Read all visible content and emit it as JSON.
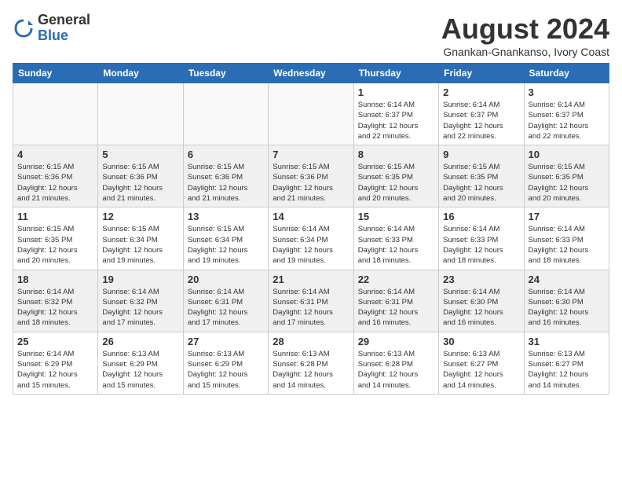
{
  "logo": {
    "general": "General",
    "blue": "Blue"
  },
  "title": {
    "month_year": "August 2024",
    "location": "Gnankan-Gnankanso, Ivory Coast"
  },
  "weekdays": [
    "Sunday",
    "Monday",
    "Tuesday",
    "Wednesday",
    "Thursday",
    "Friday",
    "Saturday"
  ],
  "weeks": [
    [
      {
        "day": "",
        "info": ""
      },
      {
        "day": "",
        "info": ""
      },
      {
        "day": "",
        "info": ""
      },
      {
        "day": "",
        "info": ""
      },
      {
        "day": "1",
        "info": "Sunrise: 6:14 AM\nSunset: 6:37 PM\nDaylight: 12 hours\nand 22 minutes."
      },
      {
        "day": "2",
        "info": "Sunrise: 6:14 AM\nSunset: 6:37 PM\nDaylight: 12 hours\nand 22 minutes."
      },
      {
        "day": "3",
        "info": "Sunrise: 6:14 AM\nSunset: 6:37 PM\nDaylight: 12 hours\nand 22 minutes."
      }
    ],
    [
      {
        "day": "4",
        "info": "Sunrise: 6:15 AM\nSunset: 6:36 PM\nDaylight: 12 hours\nand 21 minutes."
      },
      {
        "day": "5",
        "info": "Sunrise: 6:15 AM\nSunset: 6:36 PM\nDaylight: 12 hours\nand 21 minutes."
      },
      {
        "day": "6",
        "info": "Sunrise: 6:15 AM\nSunset: 6:36 PM\nDaylight: 12 hours\nand 21 minutes."
      },
      {
        "day": "7",
        "info": "Sunrise: 6:15 AM\nSunset: 6:36 PM\nDaylight: 12 hours\nand 21 minutes."
      },
      {
        "day": "8",
        "info": "Sunrise: 6:15 AM\nSunset: 6:35 PM\nDaylight: 12 hours\nand 20 minutes."
      },
      {
        "day": "9",
        "info": "Sunrise: 6:15 AM\nSunset: 6:35 PM\nDaylight: 12 hours\nand 20 minutes."
      },
      {
        "day": "10",
        "info": "Sunrise: 6:15 AM\nSunset: 6:35 PM\nDaylight: 12 hours\nand 20 minutes."
      }
    ],
    [
      {
        "day": "11",
        "info": "Sunrise: 6:15 AM\nSunset: 6:35 PM\nDaylight: 12 hours\nand 20 minutes."
      },
      {
        "day": "12",
        "info": "Sunrise: 6:15 AM\nSunset: 6:34 PM\nDaylight: 12 hours\nand 19 minutes."
      },
      {
        "day": "13",
        "info": "Sunrise: 6:15 AM\nSunset: 6:34 PM\nDaylight: 12 hours\nand 19 minutes."
      },
      {
        "day": "14",
        "info": "Sunrise: 6:14 AM\nSunset: 6:34 PM\nDaylight: 12 hours\nand 19 minutes."
      },
      {
        "day": "15",
        "info": "Sunrise: 6:14 AM\nSunset: 6:33 PM\nDaylight: 12 hours\nand 18 minutes."
      },
      {
        "day": "16",
        "info": "Sunrise: 6:14 AM\nSunset: 6:33 PM\nDaylight: 12 hours\nand 18 minutes."
      },
      {
        "day": "17",
        "info": "Sunrise: 6:14 AM\nSunset: 6:33 PM\nDaylight: 12 hours\nand 18 minutes."
      }
    ],
    [
      {
        "day": "18",
        "info": "Sunrise: 6:14 AM\nSunset: 6:32 PM\nDaylight: 12 hours\nand 18 minutes."
      },
      {
        "day": "19",
        "info": "Sunrise: 6:14 AM\nSunset: 6:32 PM\nDaylight: 12 hours\nand 17 minutes."
      },
      {
        "day": "20",
        "info": "Sunrise: 6:14 AM\nSunset: 6:31 PM\nDaylight: 12 hours\nand 17 minutes."
      },
      {
        "day": "21",
        "info": "Sunrise: 6:14 AM\nSunset: 6:31 PM\nDaylight: 12 hours\nand 17 minutes."
      },
      {
        "day": "22",
        "info": "Sunrise: 6:14 AM\nSunset: 6:31 PM\nDaylight: 12 hours\nand 16 minutes."
      },
      {
        "day": "23",
        "info": "Sunrise: 6:14 AM\nSunset: 6:30 PM\nDaylight: 12 hours\nand 16 minutes."
      },
      {
        "day": "24",
        "info": "Sunrise: 6:14 AM\nSunset: 6:30 PM\nDaylight: 12 hours\nand 16 minutes."
      }
    ],
    [
      {
        "day": "25",
        "info": "Sunrise: 6:14 AM\nSunset: 6:29 PM\nDaylight: 12 hours\nand 15 minutes."
      },
      {
        "day": "26",
        "info": "Sunrise: 6:13 AM\nSunset: 6:29 PM\nDaylight: 12 hours\nand 15 minutes."
      },
      {
        "day": "27",
        "info": "Sunrise: 6:13 AM\nSunset: 6:29 PM\nDaylight: 12 hours\nand 15 minutes."
      },
      {
        "day": "28",
        "info": "Sunrise: 6:13 AM\nSunset: 6:28 PM\nDaylight: 12 hours\nand 14 minutes."
      },
      {
        "day": "29",
        "info": "Sunrise: 6:13 AM\nSunset: 6:28 PM\nDaylight: 12 hours\nand 14 minutes."
      },
      {
        "day": "30",
        "info": "Sunrise: 6:13 AM\nSunset: 6:27 PM\nDaylight: 12 hours\nand 14 minutes."
      },
      {
        "day": "31",
        "info": "Sunrise: 6:13 AM\nSunset: 6:27 PM\nDaylight: 12 hours\nand 14 minutes."
      }
    ]
  ]
}
